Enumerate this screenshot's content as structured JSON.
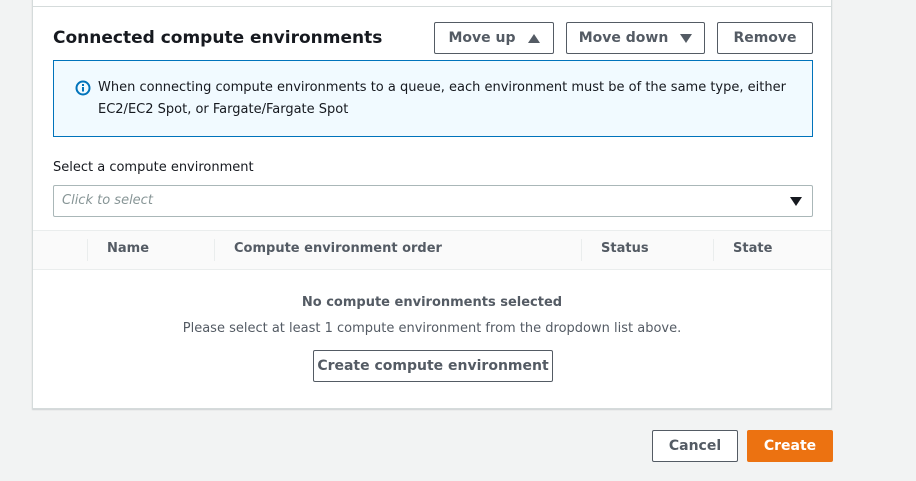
{
  "section": {
    "title": "Connected compute environments",
    "move_up_label": "Move up",
    "move_down_label": "Move down",
    "remove_label": "Remove"
  },
  "info_alert": {
    "icon": "info-icon",
    "text": "When connecting compute environments to a queue, each environment must be of the same type, either EC2/EC2 Spot, or Fargate/Fargate Spot"
  },
  "compute_select": {
    "label": "Select a compute environment",
    "placeholder": "Click to select"
  },
  "table": {
    "columns": [
      "Name",
      "Compute environment order",
      "Status",
      "State"
    ],
    "empty_title": "No compute environments selected",
    "empty_message": "Please select at least 1 compute environment from the dropdown list above.",
    "create_label": "Create compute environment"
  },
  "footer": {
    "cancel_label": "Cancel",
    "create_label": "Create"
  },
  "colors": {
    "primary": "#ec7211",
    "info_border": "#0073bb",
    "info_bg": "#f1faff"
  }
}
